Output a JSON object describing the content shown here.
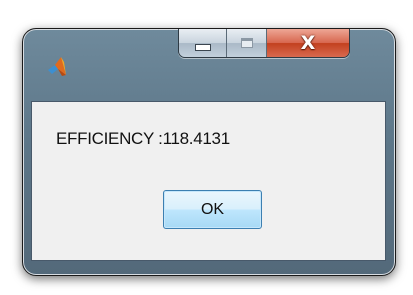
{
  "window": {
    "buttons": {
      "minimize_icon": "minimize-icon",
      "maximize_icon": "maximize-icon",
      "close_glyph": "X"
    },
    "app_icon": "matlab-logo-icon"
  },
  "dialog": {
    "message": "EFFICIENCY :118.4131",
    "ok_label": "OK"
  },
  "colors": {
    "frame": "#5d7789",
    "close_button": "#c7472a",
    "client_background": "#f0f0f0",
    "ok_button": "#bee6fd"
  }
}
